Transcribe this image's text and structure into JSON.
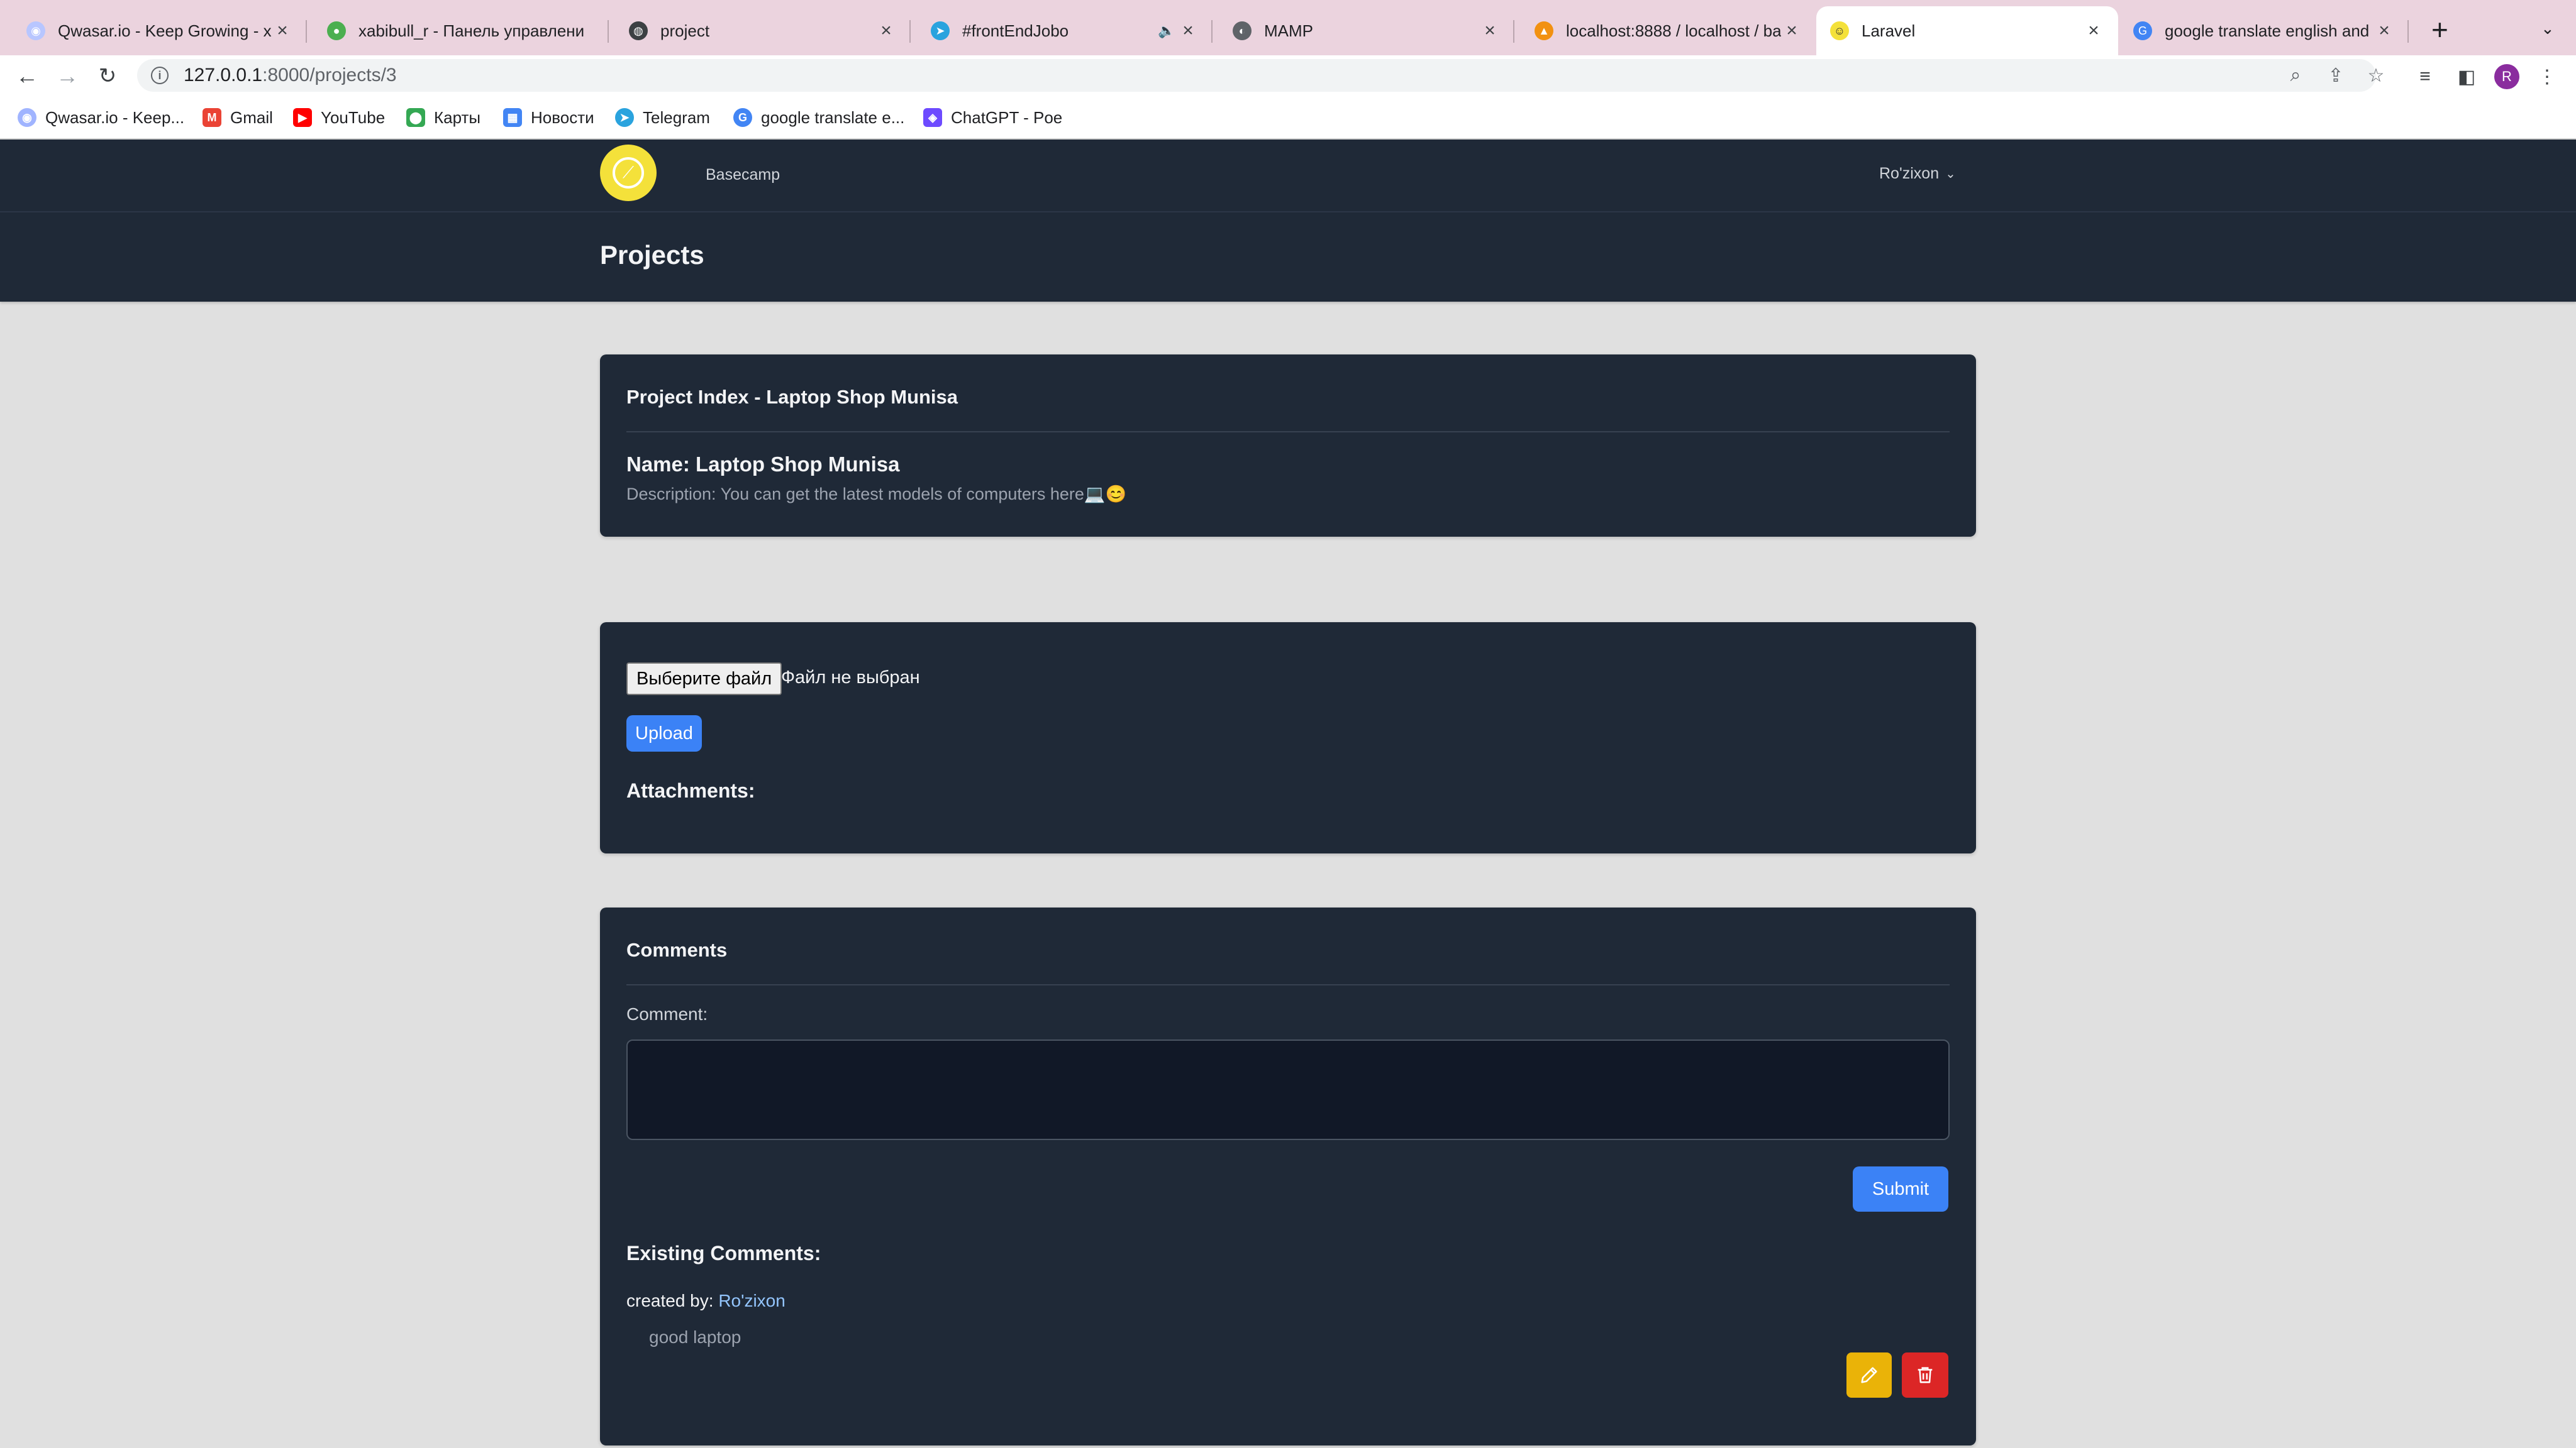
{
  "browser": {
    "tabs": [
      {
        "title": "Qwasar.io - Keep Growing - xa",
        "icon": "qwasar-icon"
      },
      {
        "title": "xabibull_r - Панель управлени",
        "icon": "eye-icon"
      },
      {
        "title": "project",
        "icon": "globe-icon"
      },
      {
        "title": "#frontEndJobo",
        "icon": "telegram-icon",
        "muted": true
      },
      {
        "title": "MAMP",
        "icon": "mamp-icon"
      },
      {
        "title": "localhost:8888 / localhost / ba",
        "icon": "phpmyadmin-icon"
      },
      {
        "title": "Laravel",
        "icon": "laravel-icon",
        "active": true
      },
      {
        "title": "google translate english and u:",
        "icon": "google-icon"
      }
    ],
    "url_host": "127.0.0.1",
    "url_path": ":8000/projects/3",
    "profile_initial": "R",
    "bookmarks": [
      {
        "label": "Qwasar.io - Keep...",
        "icon": "qwasar-icon",
        "color": "#a0b4ff"
      },
      {
        "label": "Gmail",
        "icon": "gmail-icon",
        "color": "#ea4335"
      },
      {
        "label": "YouTube",
        "icon": "youtube-icon",
        "color": "#ff0000"
      },
      {
        "label": "Карты",
        "icon": "maps-icon",
        "color": "#34a853"
      },
      {
        "label": "Новости",
        "icon": "news-icon",
        "color": "#4285f4"
      },
      {
        "label": "Telegram",
        "icon": "telegram-icon",
        "color": "#2aa3de"
      },
      {
        "label": "google translate e...",
        "icon": "google-icon",
        "color": "#4285f4"
      },
      {
        "label": "ChatGPT - Poe",
        "icon": "poe-icon",
        "color": "#6d4aff"
      }
    ]
  },
  "app": {
    "nav_link": "Basecamp",
    "user_name": "Ro'zixon",
    "page_title": "Projects"
  },
  "project": {
    "card_title": "Project Index - Laptop Shop Munisa",
    "name_line": "Name: Laptop Shop Munisa",
    "description_line": "Description: You can get the latest models of computers here💻😊"
  },
  "attachments": {
    "choose_file_label": "Выберите файл",
    "no_file_text": "Файл не выбран",
    "upload_label": "Upload",
    "heading": "Attachments:"
  },
  "comments": {
    "heading": "Comments",
    "comment_label": "Comment:",
    "comment_value": "",
    "submit_label": "Submit",
    "existing_heading": "Existing Comments:",
    "items": [
      {
        "created_by_prefix": "created by:",
        "author": "Ro'zixon",
        "body": "good laptop"
      }
    ]
  },
  "colors": {
    "nav_bg": "#1f2937",
    "page_bg": "#e0e0e0",
    "primary": "#3b82f6",
    "edit": "#eab308",
    "delete": "#dc2626",
    "logo": "#f4e13a"
  }
}
